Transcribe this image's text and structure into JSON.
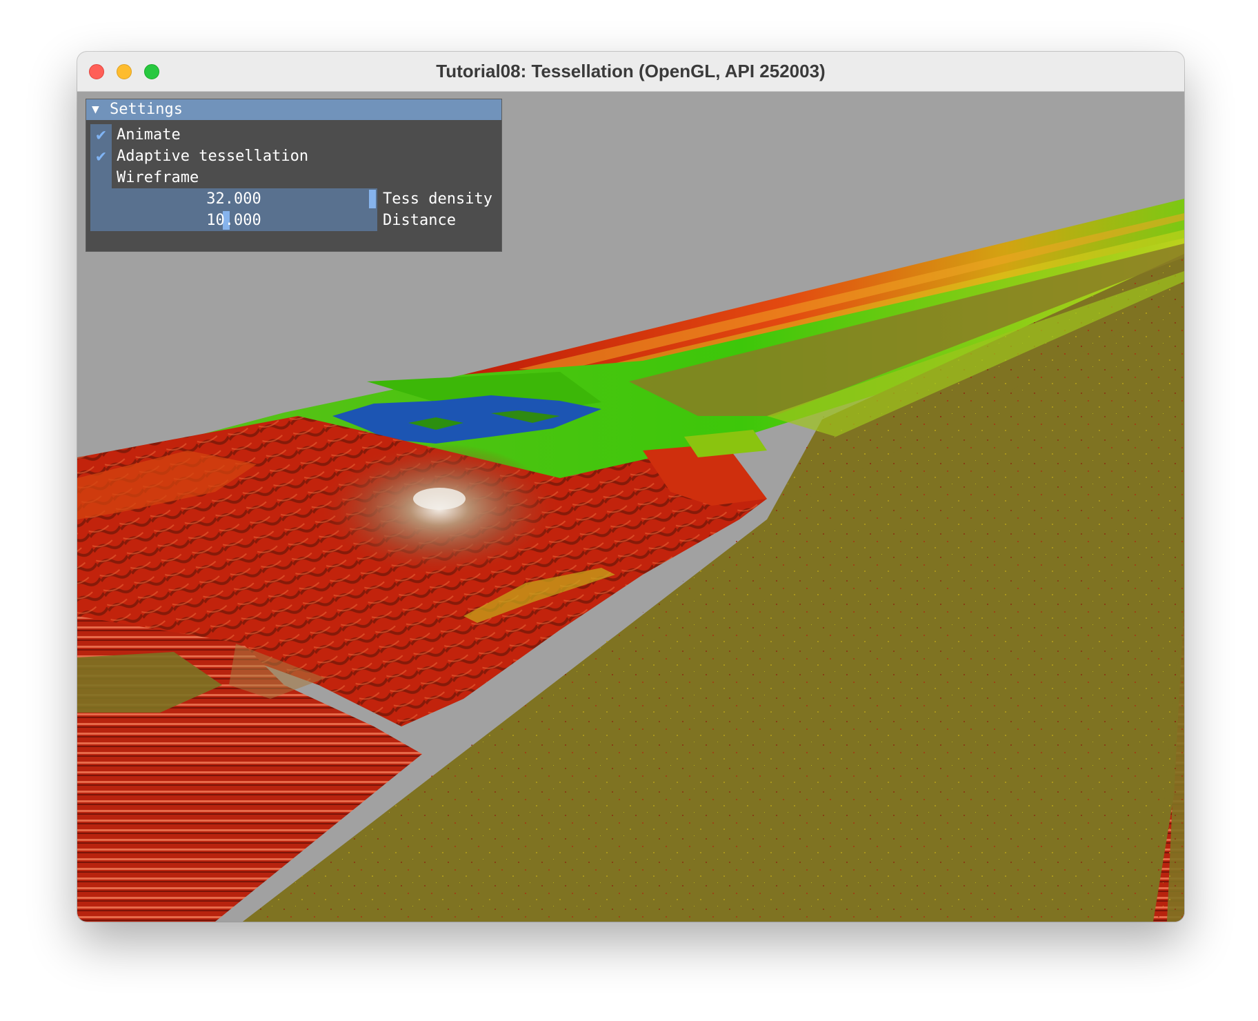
{
  "window": {
    "title": "Tutorial08: Tessellation (OpenGL, API 252003)"
  },
  "settings_panel": {
    "header": "Settings",
    "checkboxes": [
      {
        "label": "Animate",
        "checked": true
      },
      {
        "label": "Adaptive tessellation",
        "checked": true
      },
      {
        "label": "Wireframe",
        "checked": false
      }
    ],
    "sliders": [
      {
        "label": "Tess density",
        "value": "32.000"
      },
      {
        "label": "Distance",
        "value": "10.000"
      }
    ],
    "check_glyph": "✔",
    "collapse_glyph": "▼"
  },
  "colors": {
    "sky": "#a1a1a1",
    "panel_bg": "#4d4d4d",
    "panel_header": "#7193bb",
    "widget_bg": "#59718f",
    "accent": "#86b3ec",
    "terrain_olive": "#7f7322",
    "terrain_red": "#c8200d",
    "terrain_green": "#2fb300",
    "water_blue": "#1a54b0"
  }
}
